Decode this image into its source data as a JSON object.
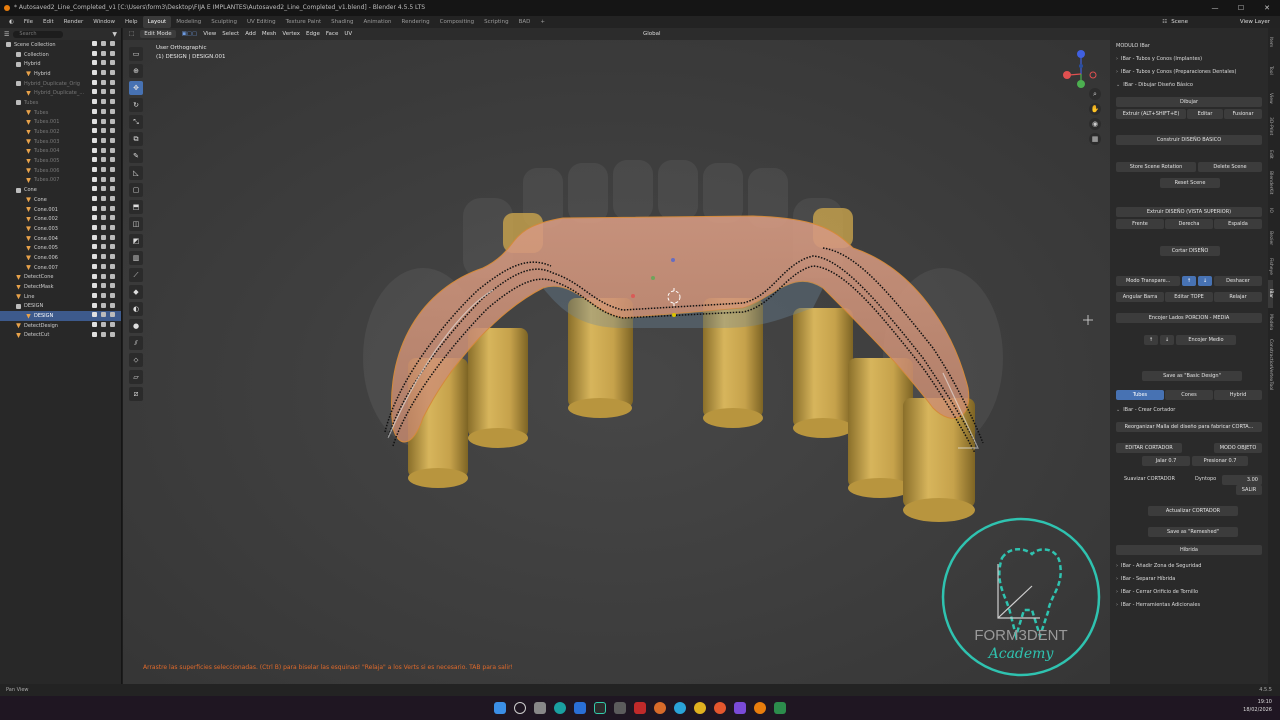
{
  "window": {
    "title": "* Autosaved2_Line_Completed_v1 [C:\\Users\\form3\\Desktop\\FIJA E IMPLANTES\\Autosaved2_Line_Completed_v1.blend] - Blender 4.5.5 LTS",
    "controls": [
      "—",
      "☐",
      "✕"
    ]
  },
  "menubar": {
    "menus": [
      "File",
      "Edit",
      "Render",
      "Window",
      "Help"
    ],
    "workspaces": [
      "Layout",
      "Modeling",
      "Sculpting",
      "UV Editing",
      "Texture Paint",
      "Shading",
      "Animation",
      "Rendering",
      "Compositing",
      "Scripting",
      "BAD"
    ],
    "active_workspace": "Layout",
    "scene": "Scene",
    "view_layer": "View Layer"
  },
  "outliner": {
    "search_placeholder": "Search",
    "rows": [
      {
        "label": "Scene Collection",
        "indent": 0,
        "kind": "collection",
        "state": "normal"
      },
      {
        "label": "Collection",
        "indent": 1,
        "kind": "collection",
        "state": "normal"
      },
      {
        "label": "Hybrid",
        "indent": 1,
        "kind": "collection",
        "state": "normal"
      },
      {
        "label": "Hybrid",
        "indent": 2,
        "kind": "mesh",
        "state": "normal"
      },
      {
        "label": "Hybrid_Duplicate_Orig",
        "indent": 1,
        "kind": "collection",
        "state": "dim"
      },
      {
        "label": "Hybrid_Duplicate_...",
        "indent": 2,
        "kind": "mesh",
        "state": "dim"
      },
      {
        "label": "Tubes",
        "indent": 1,
        "kind": "collection",
        "state": "dim"
      },
      {
        "label": "Tubes",
        "indent": 2,
        "kind": "mesh",
        "state": "dim"
      },
      {
        "label": "Tubes.001",
        "indent": 2,
        "kind": "mesh",
        "state": "dim"
      },
      {
        "label": "Tubes.002",
        "indent": 2,
        "kind": "mesh",
        "state": "dim"
      },
      {
        "label": "Tubes.003",
        "indent": 2,
        "kind": "mesh",
        "state": "dim"
      },
      {
        "label": "Tubes.004",
        "indent": 2,
        "kind": "mesh",
        "state": "dim"
      },
      {
        "label": "Tubes.005",
        "indent": 2,
        "kind": "mesh",
        "state": "dim"
      },
      {
        "label": "Tubes.006",
        "indent": 2,
        "kind": "mesh",
        "state": "dim"
      },
      {
        "label": "Tubes.007",
        "indent": 2,
        "kind": "mesh",
        "state": "dim"
      },
      {
        "label": "Cone",
        "indent": 1,
        "kind": "collection",
        "state": "normal"
      },
      {
        "label": "Cone",
        "indent": 2,
        "kind": "mesh",
        "state": "normal"
      },
      {
        "label": "Cone.001",
        "indent": 2,
        "kind": "mesh",
        "state": "normal"
      },
      {
        "label": "Cone.002",
        "indent": 2,
        "kind": "mesh",
        "state": "normal"
      },
      {
        "label": "Cone.003",
        "indent": 2,
        "kind": "mesh",
        "state": "normal"
      },
      {
        "label": "Cone.004",
        "indent": 2,
        "kind": "mesh",
        "state": "normal"
      },
      {
        "label": "Cone.005",
        "indent": 2,
        "kind": "mesh",
        "state": "normal"
      },
      {
        "label": "Cone.006",
        "indent": 2,
        "kind": "mesh",
        "state": "normal"
      },
      {
        "label": "Cone.007",
        "indent": 2,
        "kind": "mesh",
        "state": "normal"
      },
      {
        "label": "DetectCone",
        "indent": 1,
        "kind": "mesh",
        "state": "normal"
      },
      {
        "label": "DetectMask",
        "indent": 1,
        "kind": "mesh",
        "state": "normal"
      },
      {
        "label": "Line",
        "indent": 1,
        "kind": "mesh",
        "state": "normal"
      },
      {
        "label": "DESIGN",
        "indent": 1,
        "kind": "collection",
        "state": "normal"
      },
      {
        "label": "DESIGN",
        "indent": 2,
        "kind": "mesh",
        "state": "selected"
      },
      {
        "label": "DetectDesign",
        "indent": 1,
        "kind": "mesh",
        "state": "normal"
      },
      {
        "label": "DetectCut",
        "indent": 1,
        "kind": "mesh",
        "state": "normal"
      }
    ]
  },
  "viewport": {
    "mode": "Edit Mode",
    "header_menus": [
      "View",
      "Select",
      "Add",
      "Mesh",
      "Vertex",
      "Edge",
      "Face",
      "UV"
    ],
    "transform_orientation": "Global",
    "view_name": "User Orthographic",
    "object_info": "(1) DESIGN | DESIGN.001",
    "hint": "Arrastre las superficies seleccionadas. (Ctrl B) para biselar las esquinas! \"Relaja\" a los Verts si es necesario. TAB para salir!"
  },
  "npanel": {
    "module": "MODULO IBar",
    "sections": {
      "tubos_implantes": "IBar - Tubos y Conos (Implantes)",
      "tubos_prep": "IBar - Tubos y Conos (Preparaciones Dentales)",
      "dibujar": "IBar - Dibujar Diseño Básico",
      "crear_cortador": "IBar - Crear Cortador",
      "zona_seguridad": "IBar - Añadir Zona de Seguridad",
      "separar": "IBar - Separar Híbrida",
      "cerrar": "IBar - Cerrar Orificio de Tornillo",
      "herramientas": "IBar - Herramientas Adicionales"
    },
    "buttons": {
      "dibujar": "Dibujar",
      "extruir": "Extruir (ALT+SHIFT+E)",
      "editar": "Editar",
      "fusionar": "Fusionar",
      "construir": "Construir DISEÑO BASICO",
      "store_rotation": "Store Scene Rotation",
      "delete_scene": "Delete Scene",
      "reset_scene": "Reset Scene",
      "extruir_diseno": "Extruir DISEÑO (VISTA SUPERIOR)",
      "frente": "Frente",
      "derecha": "Derecha",
      "espalda": "Espalda",
      "cortar": "Cortar DISEÑO",
      "modo_transp": "Modo Transpare...",
      "deshacer": "Deshacer",
      "angular": "Angular Barra",
      "editar_tope": "Editar TOPE",
      "relajar": "Relajar",
      "encojer_lados": "Encojer Lados PORCION - MEDIA",
      "encojer_medio": "Encojer Medio",
      "save_basic": "Save as \"Basic Design\"",
      "tubes": "Tubes",
      "cones": "Cones",
      "hybrid": "Hybrid",
      "reorganizar": "Reorganizar Malla del diseño para fabricar CORTA...",
      "editar_cortador": "EDITAR CORTADOR",
      "modo_objeto": "MODO OBJETO",
      "jalar": "Jalar 0.7",
      "presionar": "Presionar 0.7",
      "suavizar": "Suavizar CORTADOR",
      "dyntopo": "Dyntopo",
      "dyntopo_val": "3.00",
      "salir": "SALIR",
      "actualizar": "Actualizar CORTADOR",
      "save_remeshed": "Save as \"Remeshed\"",
      "hibrida": "Híbrida"
    },
    "tabs": [
      "Item",
      "Tool",
      "View",
      "3D-Print",
      "Edit",
      "BlenderKit",
      "IO",
      "Bezier",
      "Fisheye",
      "IBar",
      "Modelo",
      "Constraction",
      "VertexTool"
    ]
  },
  "logo": {
    "line1": "FORM3DENT",
    "line2": "Academy"
  },
  "statusbar": {
    "left": "Pan View",
    "right": "4.5.5"
  },
  "clock": {
    "time": "19:10",
    "date": "18/02/2026"
  },
  "colors": {
    "accent": "#4772b3",
    "hint": "#e06a2b",
    "logo": "#2fc3b0",
    "orange": "#e87d0d"
  }
}
